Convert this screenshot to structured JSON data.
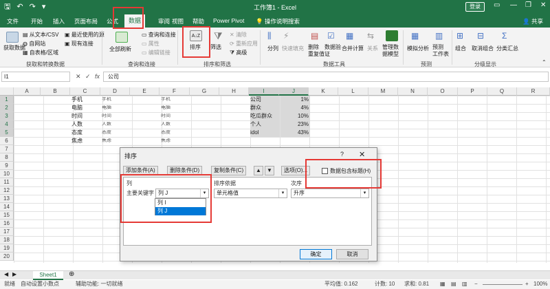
{
  "titlebar": {
    "title": "工作簿1 - Excel",
    "signin": "登录",
    "share": "共享"
  },
  "tabs": [
    "文件",
    "开始",
    "插入",
    "页面布局",
    "公式",
    "数据",
    "审阅",
    "视图",
    "帮助",
    "Power Pivot",
    "操作说明搜索"
  ],
  "ribbon": {
    "get_data": "获取数据",
    "from_text": "从文本/CSV",
    "from_web": "自网站",
    "from_table": "自表格/区域",
    "recent_sources": "最近使用的源",
    "existing_conn": "现有连接",
    "refresh_all": "全部刷新",
    "queries_conn": "查询和连接",
    "properties": "属性",
    "edit_links": "编辑链接",
    "sort": "排序",
    "filter": "筛选",
    "clear": "清除",
    "reapply": "重新应用",
    "advanced": "高级",
    "split": "分列",
    "flash_fill": "快速填充",
    "remove_dup": "删除\n重复值",
    "data_validation": "数据验\n证",
    "consolidate": "合并计算",
    "relationships": "关系",
    "manage_model": "管理数\n据模型",
    "what_if": "模拟分析",
    "forecast_sheet": "预测\n工作表",
    "group": "组合",
    "ungroup": "取消组合",
    "subtotal": "分类汇总",
    "groups": {
      "get_transform": "获取和转换数据",
      "queries": "查询和连接",
      "sort_filter": "排序和筛选",
      "data_tools": "数据工具",
      "forecast": "预测",
      "outline": "分级显示"
    }
  },
  "formula_bar": {
    "name_box": "I1",
    "fx": "fx",
    "content": "公司"
  },
  "columns": [
    "A",
    "B",
    "C",
    "D",
    "E",
    "F",
    "G",
    "H",
    "I",
    "J",
    "K",
    "L",
    "M",
    "N",
    "O",
    "P",
    "Q",
    "R"
  ],
  "rows": [
    "1",
    "2",
    "3",
    "4",
    "5",
    "6",
    "7",
    "8",
    "9",
    "10",
    "11",
    "12",
    "13",
    "14",
    "15",
    "16",
    "17",
    "18",
    "19",
    "20"
  ],
  "cells": {
    "C": [
      "手机",
      "电脑",
      "时间",
      "人数",
      "态度",
      "焦虑"
    ],
    "D": [
      "手机",
      "电脑",
      "时间",
      "人数",
      "态度",
      "焦虑"
    ],
    "F": [
      "手机",
      "电脑",
      "时间",
      "人数",
      "态度",
      "焦虑"
    ],
    "I": [
      "公司",
      "群众",
      "吃瓜群众",
      "个人",
      "idol"
    ],
    "J": [
      "1%",
      "4%",
      "10%",
      "23%",
      "43%"
    ]
  },
  "dialog": {
    "title": "排序",
    "help": "?",
    "close": "✕",
    "add_level": "添加条件(A)",
    "delete_level": "删除条件(D)",
    "copy_level": "复制条件(C)",
    "options": "选项(O)...",
    "has_headers": "数据包含标题(H)",
    "col_header": "列",
    "sort_on_header": "排序依据",
    "order_header": "次序",
    "primary_key": "主要关键字",
    "column_value": "列 J",
    "sort_on_value": "单元格值",
    "order_value": "升序",
    "dropdown_options": [
      "列 I",
      "列 J"
    ],
    "ok": "确定",
    "cancel": "取消"
  },
  "sheet_tab": "Sheet1",
  "status": {
    "ready": "就绪",
    "autosave": "自动设置小数点",
    "accessibility": "辅助功能: 一切就绪",
    "average": "平均值: 0.162",
    "count": "计数: 10",
    "sum": "求和: 0.81",
    "zoom": "100%"
  },
  "colors": {
    "excel_green": "#217346",
    "highlight_red": "#e53935",
    "selection_blue": "#0078d7"
  }
}
